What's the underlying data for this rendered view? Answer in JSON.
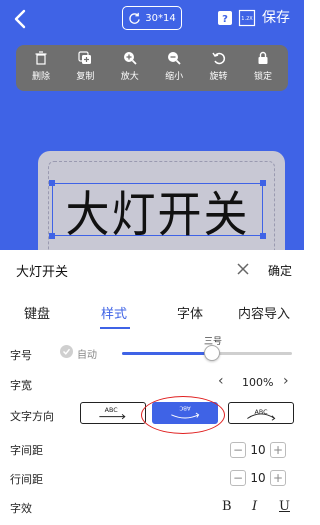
{
  "header": {
    "size_text": "30*14",
    "save_label": "保存"
  },
  "toolbar": [
    {
      "label": "删除",
      "icon": "trash-icon"
    },
    {
      "label": "复制",
      "icon": "copy-icon"
    },
    {
      "label": "放大",
      "icon": "zoom-in-icon"
    },
    {
      "label": "缩小",
      "icon": "zoom-out-icon"
    },
    {
      "label": "旋转",
      "icon": "rotate-icon"
    },
    {
      "label": "锁定",
      "icon": "lock-icon"
    }
  ],
  "canvas": {
    "label_text": "大灯开关"
  },
  "editor": {
    "input_value": "大灯开关",
    "confirm_label": "确定"
  },
  "tabs": [
    {
      "label": "键盘",
      "active": false
    },
    {
      "label": "样式",
      "active": true
    },
    {
      "label": "字体",
      "active": false
    },
    {
      "label": "内容导入",
      "active": false
    }
  ],
  "style": {
    "font_size_label": "字号",
    "auto_label": "自动",
    "font_size_value": "三号",
    "font_size_fraction": 0.53,
    "font_width_label": "字宽",
    "font_width_value": "100%",
    "direction_label": "文字方向",
    "direction_options": [
      "ABC",
      "ABC",
      "ABC"
    ],
    "direction_selected_index": 1,
    "char_spacing_label": "字间距",
    "char_spacing_value": "10",
    "line_spacing_label": "行间距",
    "line_spacing_value": "10",
    "text_effect_label": "字效",
    "effects": [
      "B",
      "I",
      "U"
    ]
  },
  "colors": {
    "accent": "#3f63e6",
    "toolbar_bg": "#6f6f6f",
    "highlight_ring": "#e02020"
  }
}
